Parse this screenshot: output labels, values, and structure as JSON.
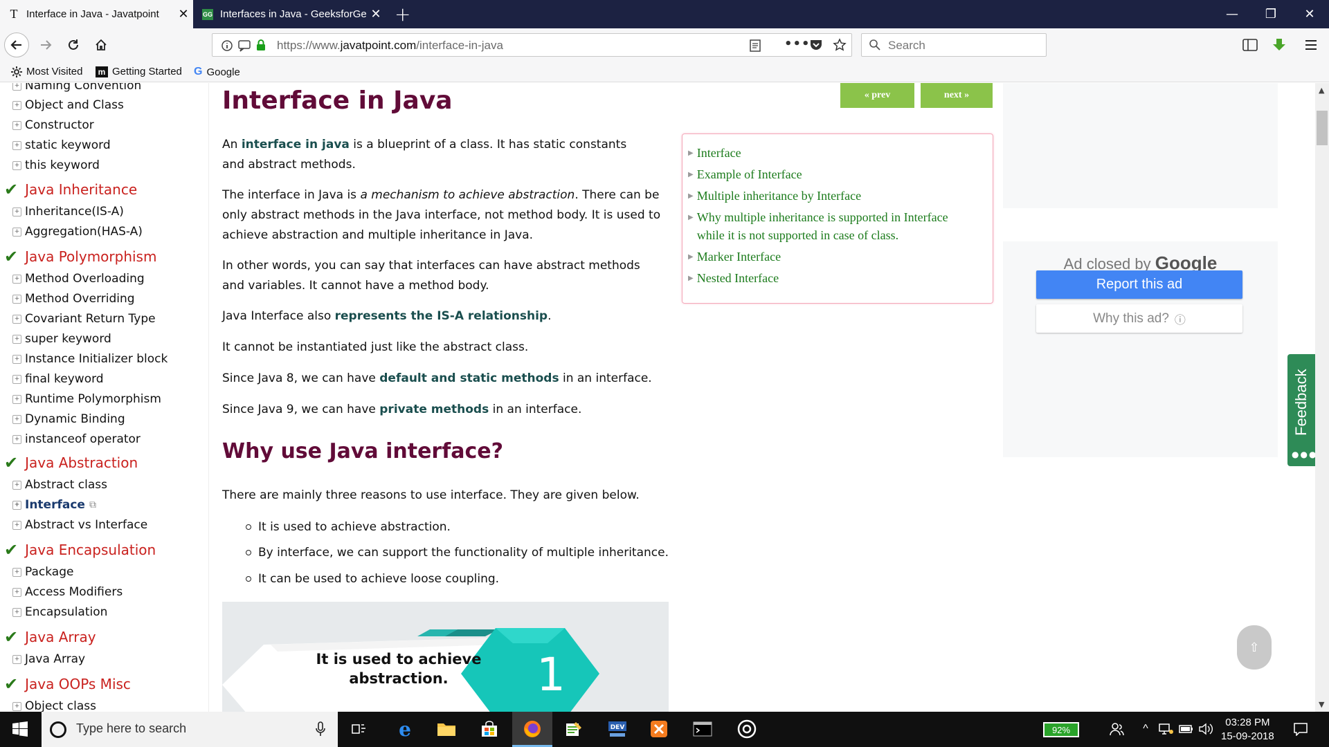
{
  "browser": {
    "tabs": [
      {
        "title": "Interface in Java - Javatpoint"
      },
      {
        "title": "Interfaces in Java - GeeksforGe"
      }
    ],
    "url_prefix": "https://www.",
    "url_domain": "javatpoint.com",
    "url_path": "/interface-in-java",
    "search_placeholder": "Search",
    "bookmarks": [
      "Most Visited",
      "Getting Started",
      "Google"
    ]
  },
  "sidebar": {
    "partial_top": "Naming Convention",
    "items_top": [
      "Object and Class",
      "Constructor",
      "static keyword",
      "this keyword"
    ],
    "sections": [
      {
        "title": "Java Inheritance",
        "items": [
          "Inheritance(IS-A)",
          "Aggregation(HAS-A)"
        ]
      },
      {
        "title": "Java Polymorphism",
        "items": [
          "Method Overloading",
          "Method Overriding",
          "Covariant Return Type",
          "super keyword",
          "Instance Initializer block",
          "final keyword",
          "Runtime Polymorphism",
          "Dynamic Binding",
          "instanceof operator"
        ]
      },
      {
        "title": "Java Abstraction",
        "items": [
          "Abstract class",
          "Interface",
          "Abstract vs Interface"
        ]
      },
      {
        "title": "Java Encapsulation",
        "items": [
          "Package",
          "Access Modifiers",
          "Encapsulation"
        ]
      },
      {
        "title": "Java Array",
        "items": [
          "Java Array"
        ]
      },
      {
        "title": "Java OOPs Misc",
        "items": [
          "Object class"
        ]
      }
    ]
  },
  "main": {
    "title": "Interface in Java",
    "prev_label": "« prev",
    "next_label": "next »",
    "p1": {
      "a": "An ",
      "kw": "interface in java",
      "b": " is a blueprint of a class. It has static constants and abstract methods."
    },
    "p2": {
      "a": "The interface in Java is ",
      "em": "a mechanism to achieve abstraction",
      "b": ". There can be only abstract methods in the Java interface, not method body. It is used to achieve abstraction and multiple inheritance in Java."
    },
    "p3": "In other words, you can say that interfaces can have abstract methods and variables. It cannot have a method body.",
    "p4": {
      "a": "Java Interface also ",
      "kw": "represents the IS-A relationship",
      "b": "."
    },
    "p5": "It cannot be instantiated just like the abstract class.",
    "p6": {
      "a": "Since Java 8, we can have ",
      "kw": "default and static methods",
      "b": " in an interface."
    },
    "p7": {
      "a": "Since Java 9, we can have ",
      "kw": "private methods",
      "b": " in an interface."
    },
    "h2": "Why use Java interface?",
    "p8": "There are mainly three reasons to use interface. They are given below.",
    "bullets": [
      "It is used to achieve abstraction.",
      "By interface, we can support the functionality of multiple inheritance.",
      "It can be used to achieve loose coupling."
    ],
    "toc": [
      "Interface",
      "Example of Interface",
      "Multiple inheritance by Interface",
      "Why multiple inheritance is supported in Interface",
      "while it is not supported in case of class.",
      "Marker Interface",
      "Nested Interface"
    ],
    "illustration": {
      "line1": "It is used to achieve",
      "line2": "abstraction.",
      "number": "1"
    }
  },
  "ads": {
    "closed_by": "Ad closed by",
    "google": "Google",
    "report": "Report this ad",
    "why": "Why this ad?",
    "feedback": "Feedback"
  },
  "taskbar": {
    "search_placeholder": "Type here to search",
    "battery": "92%",
    "time": "03:28 PM",
    "date": "15-09-2018"
  }
}
